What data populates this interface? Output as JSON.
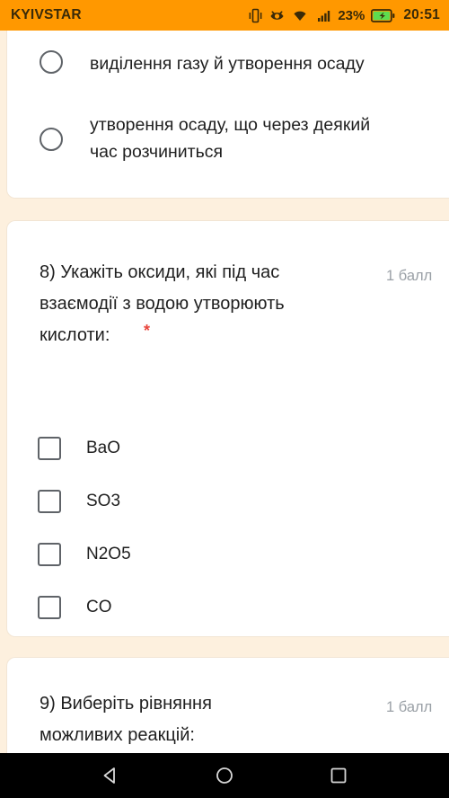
{
  "status_bar": {
    "carrier": "KYIVSTAR",
    "clock": "20:51",
    "battery_percent": "23%",
    "icons": [
      "vibrate-icon",
      "eye-comfort-icon",
      "wifi-icon",
      "signal-bars-icon",
      "battery-charging-icon"
    ],
    "background_color": "#ff9800",
    "text_color": "#3a2a08"
  },
  "theme": {
    "page_background": "#fdf0de",
    "card_background": "#ffffff",
    "text_color": "#1f1f1f",
    "muted_text_color": "#9aa0a6",
    "required_star_color": "#e8453c",
    "control_outline_color": "#5f6368"
  },
  "cards": {
    "question7": {
      "options": [
        {
          "label": "виділення газу й утворення осаду",
          "type": "radio",
          "checked": false
        },
        {
          "label": "утворення осаду, що через деякий\nчас розчиниться",
          "type": "radio",
          "checked": false
        }
      ]
    },
    "question8": {
      "number": "8)",
      "text": "8) Укажіть оксиди, які під час\nвзаємодії з водою утворюють\nкислоти:",
      "required_marker": "*",
      "points": "1 балл",
      "options": [
        {
          "label": "BaO",
          "type": "checkbox",
          "checked": false
        },
        {
          "label": "SO3",
          "type": "checkbox",
          "checked": false
        },
        {
          "label": "N2O5",
          "type": "checkbox",
          "checked": false
        },
        {
          "label": "CO",
          "type": "checkbox",
          "checked": false
        }
      ]
    },
    "question9": {
      "number": "9)",
      "text": "9) Виберіть рівняння\nможливих реакцій:",
      "points": "1 балл"
    }
  },
  "nav_bar": {
    "background_color": "#000000",
    "buttons": [
      {
        "name": "back-button",
        "icon": "back-triangle-icon"
      },
      {
        "name": "home-button",
        "icon": "home-circle-icon"
      },
      {
        "name": "recents-button",
        "icon": "recents-square-icon"
      }
    ]
  }
}
